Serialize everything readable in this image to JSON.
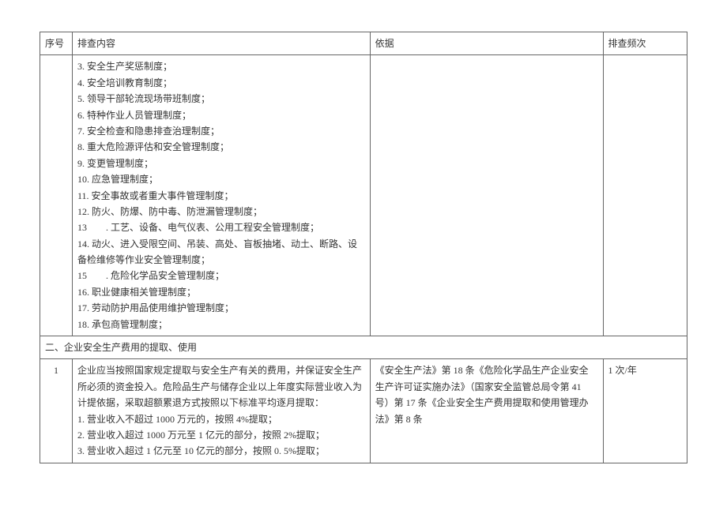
{
  "headers": {
    "seq": "序号",
    "content": "排查内容",
    "basis": "依据",
    "freq": "排查频次"
  },
  "row1": {
    "seq": "",
    "content_lines": [
      "3. 安全生产奖惩制度；",
      "4. 安全培训教育制度；",
      "5. 领导干部轮流现场带班制度；",
      "6. 特种作业人员管理制度；",
      "7. 安全检查和隐患排查治理制度；",
      "8. 重大危险源评估和安全管理制度；",
      "9. 变更管理制度；",
      "10. 应急管理制度；",
      "11. 安全事故或者重大事件管理制度；",
      "12. 防火、防爆、防中毒、防泄漏管理制度；",
      "13　　. 工艺、设备、电气仪表、公用工程安全管理制度；",
      "14. 动火、进入受限空间、吊装、高处、盲板抽堵、动土、断路、设备检维修等作业安全管理制度；",
      "15　　. 危险化学品安全管理制度；",
      "16. 职业健康相关管理制度；",
      "17. 劳动防护用品使用维护管理制度；",
      "18. 承包商管理制度；"
    ],
    "basis": "",
    "freq": ""
  },
  "section": {
    "label": "二、企业安全生产费用的提取、使用"
  },
  "row2": {
    "seq": "1",
    "content_lines": [
      "企业应当按照国家规定提取与安全生产有关的费用，并保证安全生产所必须的资金投入。危险品生产与储存企业以上年度实际营业收入为计提依据，采取超额累退方式按照以下标准平均逐月提取：",
      "1. 营业收入不超过 1000 万元的，按照 4%提取；",
      "2. 营业收入超过 1000 万元至 1 亿元的部分，按照 2%提取；",
      "3. 营业收入超过 1 亿元至 10 亿元的部分，按照 0. 5%提取；"
    ],
    "basis": "《安全生产法》第 18 条《危险化学品生产企业安全生产许可证实施办法》（国家安全监管总局令第 41 号）第 17 条《企业安全生产费用提取和使用管理办法》第 8 条",
    "freq": "1 次/年"
  }
}
